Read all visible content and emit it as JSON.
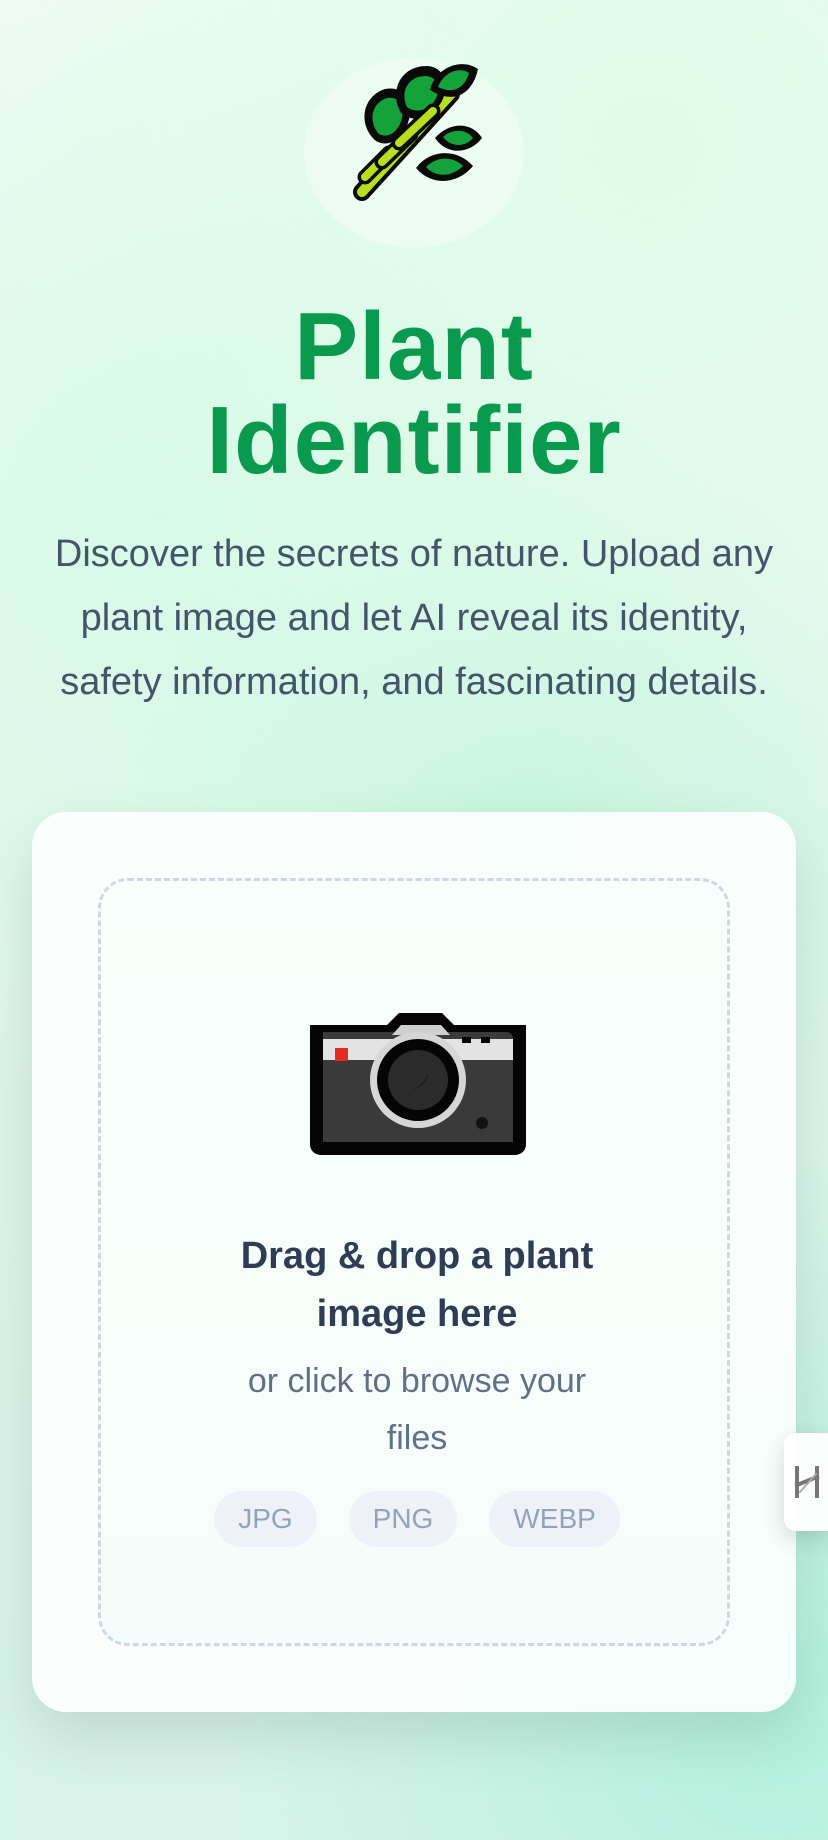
{
  "hero": {
    "title_line_1": "Plant",
    "title_line_2": "Identifier",
    "subtitle_line_1": "Discover the secrets of nature. Upload any",
    "subtitle_line_2": "plant image and let AI reveal its identity,",
    "subtitle_line_3": "safety information, and fascinating details.",
    "logo_icon": "plant-sprout-icon"
  },
  "upload": {
    "camera_icon": "camera-icon",
    "title_line_1": "Drag & drop a plant",
    "title_line_2": "image here",
    "help_line_1": "or click to browse your",
    "help_line_2": "files",
    "formats": [
      "JPG",
      "PNG",
      "WEBP"
    ]
  },
  "side_tab": {
    "icon": "h-logo-icon"
  },
  "colors": {
    "title_green": "#0a9a4f",
    "subtitle": "#44546b",
    "drop_title": "#2e3c54",
    "drop_help": "#617089",
    "pill_bg": "#eef2f8",
    "pill_text": "#94a3b8"
  }
}
